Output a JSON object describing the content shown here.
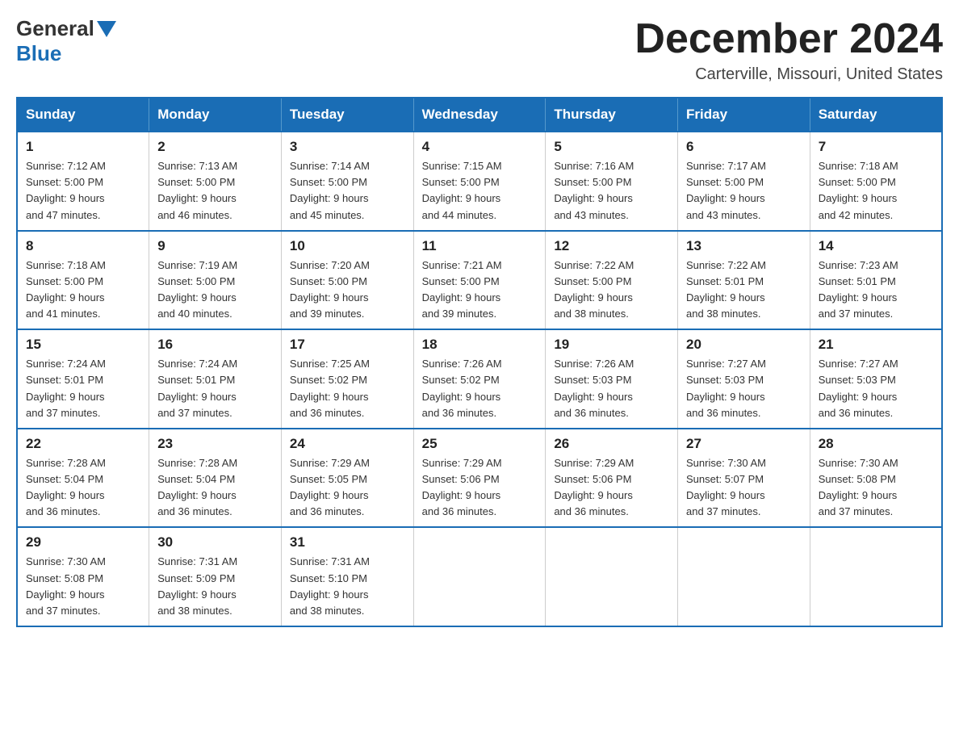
{
  "logo": {
    "general": "General",
    "blue": "Blue"
  },
  "header": {
    "month_year": "December 2024",
    "location": "Carterville, Missouri, United States"
  },
  "days_of_week": [
    "Sunday",
    "Monday",
    "Tuesday",
    "Wednesday",
    "Thursday",
    "Friday",
    "Saturday"
  ],
  "weeks": [
    [
      {
        "day": "1",
        "sunrise": "7:12 AM",
        "sunset": "5:00 PM",
        "daylight": "9 hours and 47 minutes."
      },
      {
        "day": "2",
        "sunrise": "7:13 AM",
        "sunset": "5:00 PM",
        "daylight": "9 hours and 46 minutes."
      },
      {
        "day": "3",
        "sunrise": "7:14 AM",
        "sunset": "5:00 PM",
        "daylight": "9 hours and 45 minutes."
      },
      {
        "day": "4",
        "sunrise": "7:15 AM",
        "sunset": "5:00 PM",
        "daylight": "9 hours and 44 minutes."
      },
      {
        "day": "5",
        "sunrise": "7:16 AM",
        "sunset": "5:00 PM",
        "daylight": "9 hours and 43 minutes."
      },
      {
        "day": "6",
        "sunrise": "7:17 AM",
        "sunset": "5:00 PM",
        "daylight": "9 hours and 43 minutes."
      },
      {
        "day": "7",
        "sunrise": "7:18 AM",
        "sunset": "5:00 PM",
        "daylight": "9 hours and 42 minutes."
      }
    ],
    [
      {
        "day": "8",
        "sunrise": "7:18 AM",
        "sunset": "5:00 PM",
        "daylight": "9 hours and 41 minutes."
      },
      {
        "day": "9",
        "sunrise": "7:19 AM",
        "sunset": "5:00 PM",
        "daylight": "9 hours and 40 minutes."
      },
      {
        "day": "10",
        "sunrise": "7:20 AM",
        "sunset": "5:00 PM",
        "daylight": "9 hours and 39 minutes."
      },
      {
        "day": "11",
        "sunrise": "7:21 AM",
        "sunset": "5:00 PM",
        "daylight": "9 hours and 39 minutes."
      },
      {
        "day": "12",
        "sunrise": "7:22 AM",
        "sunset": "5:00 PM",
        "daylight": "9 hours and 38 minutes."
      },
      {
        "day": "13",
        "sunrise": "7:22 AM",
        "sunset": "5:01 PM",
        "daylight": "9 hours and 38 minutes."
      },
      {
        "day": "14",
        "sunrise": "7:23 AM",
        "sunset": "5:01 PM",
        "daylight": "9 hours and 37 minutes."
      }
    ],
    [
      {
        "day": "15",
        "sunrise": "7:24 AM",
        "sunset": "5:01 PM",
        "daylight": "9 hours and 37 minutes."
      },
      {
        "day": "16",
        "sunrise": "7:24 AM",
        "sunset": "5:01 PM",
        "daylight": "9 hours and 37 minutes."
      },
      {
        "day": "17",
        "sunrise": "7:25 AM",
        "sunset": "5:02 PM",
        "daylight": "9 hours and 36 minutes."
      },
      {
        "day": "18",
        "sunrise": "7:26 AM",
        "sunset": "5:02 PM",
        "daylight": "9 hours and 36 minutes."
      },
      {
        "day": "19",
        "sunrise": "7:26 AM",
        "sunset": "5:03 PM",
        "daylight": "9 hours and 36 minutes."
      },
      {
        "day": "20",
        "sunrise": "7:27 AM",
        "sunset": "5:03 PM",
        "daylight": "9 hours and 36 minutes."
      },
      {
        "day": "21",
        "sunrise": "7:27 AM",
        "sunset": "5:03 PM",
        "daylight": "9 hours and 36 minutes."
      }
    ],
    [
      {
        "day": "22",
        "sunrise": "7:28 AM",
        "sunset": "5:04 PM",
        "daylight": "9 hours and 36 minutes."
      },
      {
        "day": "23",
        "sunrise": "7:28 AM",
        "sunset": "5:04 PM",
        "daylight": "9 hours and 36 minutes."
      },
      {
        "day": "24",
        "sunrise": "7:29 AM",
        "sunset": "5:05 PM",
        "daylight": "9 hours and 36 minutes."
      },
      {
        "day": "25",
        "sunrise": "7:29 AM",
        "sunset": "5:06 PM",
        "daylight": "9 hours and 36 minutes."
      },
      {
        "day": "26",
        "sunrise": "7:29 AM",
        "sunset": "5:06 PM",
        "daylight": "9 hours and 36 minutes."
      },
      {
        "day": "27",
        "sunrise": "7:30 AM",
        "sunset": "5:07 PM",
        "daylight": "9 hours and 37 minutes."
      },
      {
        "day": "28",
        "sunrise": "7:30 AM",
        "sunset": "5:08 PM",
        "daylight": "9 hours and 37 minutes."
      }
    ],
    [
      {
        "day": "29",
        "sunrise": "7:30 AM",
        "sunset": "5:08 PM",
        "daylight": "9 hours and 37 minutes."
      },
      {
        "day": "30",
        "sunrise": "7:31 AM",
        "sunset": "5:09 PM",
        "daylight": "9 hours and 38 minutes."
      },
      {
        "day": "31",
        "sunrise": "7:31 AM",
        "sunset": "5:10 PM",
        "daylight": "9 hours and 38 minutes."
      },
      null,
      null,
      null,
      null
    ]
  ],
  "labels": {
    "sunrise": "Sunrise: ",
    "sunset": "Sunset: ",
    "daylight": "Daylight: "
  }
}
